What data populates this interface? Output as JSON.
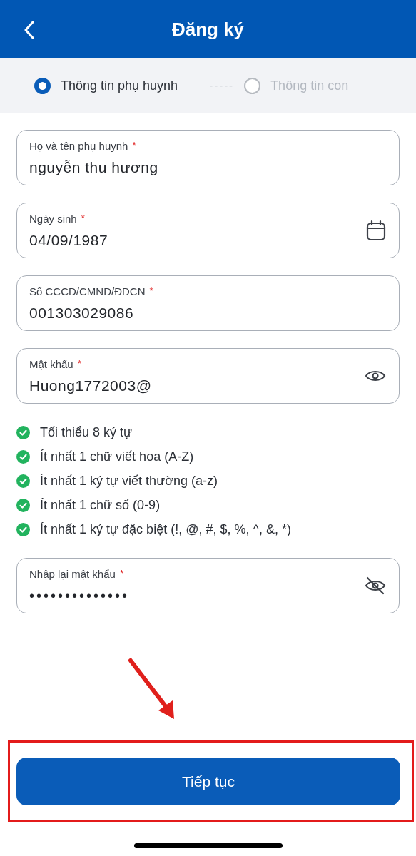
{
  "header": {
    "title": "Đăng ký"
  },
  "steps": [
    {
      "label": "Thông tin phụ huynh",
      "selected": true
    },
    {
      "label": "Thông tin con",
      "selected": false
    }
  ],
  "step_connector": "-----",
  "fields": [
    {
      "kind": "text",
      "label": "Họ và tên phụ huynh",
      "required_mark": "*",
      "value": "nguyễn thu hương"
    },
    {
      "kind": "date",
      "label": "Ngày sinh",
      "required_mark": "*",
      "value": "04/09/1987"
    },
    {
      "kind": "text",
      "label": "Số CCCD/CMND/ĐDCN",
      "required_mark": "*",
      "value": "001303029086"
    },
    {
      "kind": "password_shown",
      "label": "Mật khẩu",
      "required_mark": "*",
      "value": "Huong1772003@"
    }
  ],
  "password_rules": [
    {
      "text": "Tối thiểu 8 ký tự",
      "met": true
    },
    {
      "text": "Ít nhất 1 chữ viết hoa (A-Z)",
      "met": true
    },
    {
      "text": "Ít nhất 1 ký tự viết thường (a-z)",
      "met": true
    },
    {
      "text": "Ít nhất 1 chữ số (0-9)",
      "met": true
    },
    {
      "text": "Ít nhất 1 ký tự đặc biệt (!, @, #, $, %, ^, &, *)",
      "met": true
    }
  ],
  "confirm_field": {
    "kind": "password_hidden",
    "label": "Nhập lại mật khẩu",
    "required_mark": "*",
    "value": "••••••••••••••"
  },
  "submit_button": "Tiếp tục"
}
